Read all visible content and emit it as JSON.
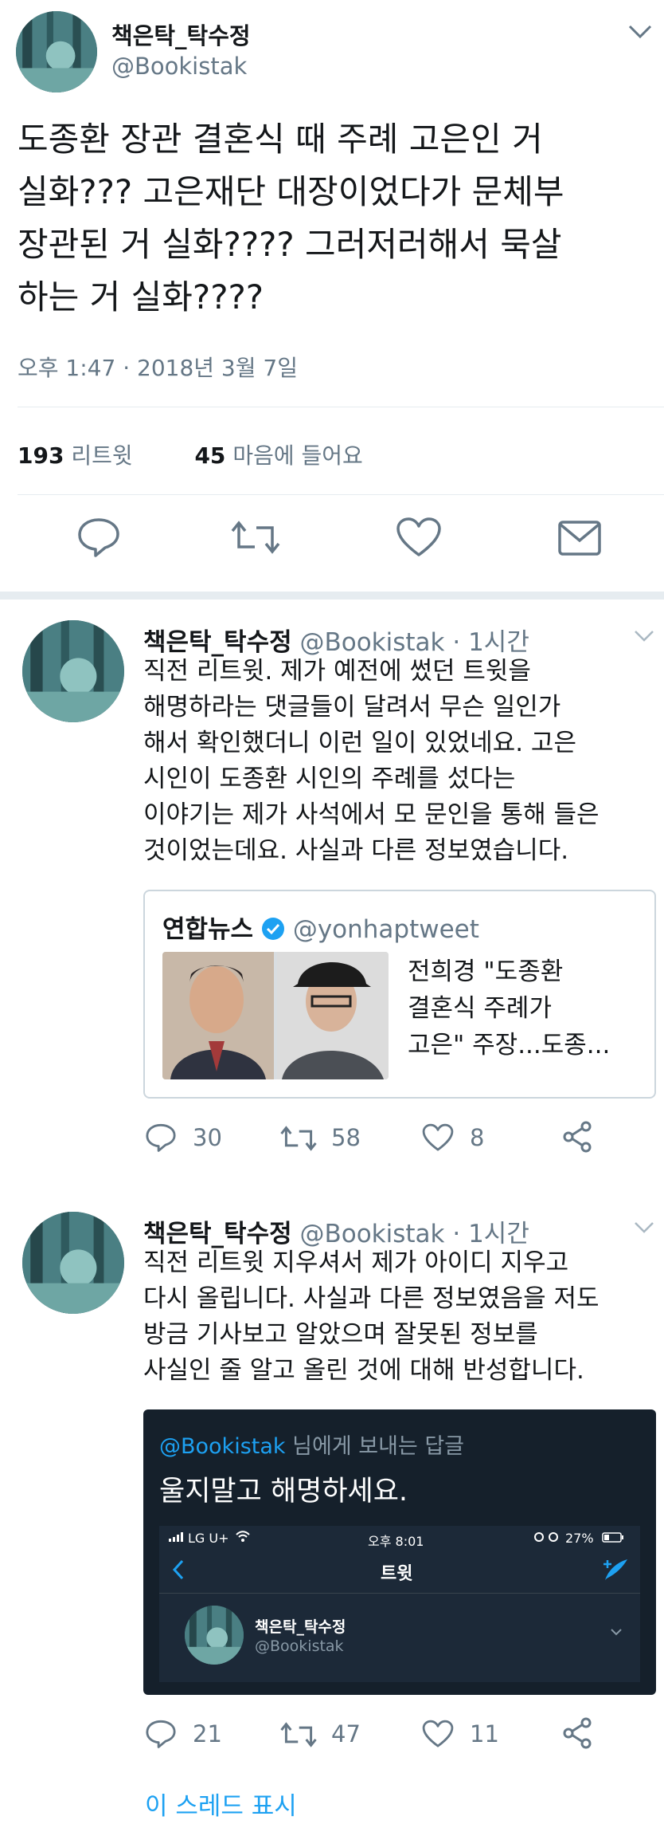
{
  "main_tweet": {
    "display_name": "책은탁_탁수정",
    "handle": "@Bookistak",
    "text_lines": [
      "도종환 장관 결혼식 때 주례 고은인 거",
      "실화??? 고은재단 대장이었다가 문체부",
      "장관된 거 실화???? 그러저러해서 묵살",
      "하는 거 실화????"
    ],
    "timestamp": "오후 1:47 · 2018년 3월 7일",
    "retweet_count": "193",
    "retweet_label": "리트윗",
    "like_count": "45",
    "like_label": "마음에 들어요"
  },
  "reply1": {
    "display_name": "책은탁_탁수정",
    "handle": "@Bookistak",
    "time": "· 1시간",
    "text_lines": [
      "직전 리트윗. 제가 예전에 썼던 트윗을",
      "해명하라는 댓글들이 달려서 무슨 일인가",
      "해서 확인했더니 이런 일이 있었네요. 고은",
      "시인이 도종환 시인의 주례를 섰다는",
      "이야기는 제가 사석에서 모 문인을 통해 들은",
      "것이었는데요. 사실과 다른 정보였습니다."
    ],
    "quote": {
      "name": "연합뉴스",
      "handle": "@yonhaptweet",
      "text_lines": [
        "전희경 \"도종환",
        "결혼식 주례가",
        "고은\" 주장...도종..."
      ]
    },
    "reply_count": "30",
    "retweet_count": "58",
    "like_count": "8"
  },
  "reply2": {
    "display_name": "책은탁_탁수정",
    "handle": "@Bookistak",
    "time": "· 1시간",
    "text_lines": [
      "직전 리트윗 지우셔서 제가 아이디 지우고",
      "다시 올립니다. 사실과 다른 정보였음을 저도",
      "방금 기사보고 알았으며 잘못된 정보를",
      "사실인 줄 알고 올린 것에 대해 반성합니다."
    ],
    "image": {
      "reply_to_handle": "@Bookistak",
      "reply_to_label": "님에게 보내는 답글",
      "headline": "울지말고 해명하세요.",
      "status_carrier": "LG U+",
      "status_time": "오후 8:01",
      "status_battery": "27%",
      "nav_title": "트윗",
      "inner_name": "책은탁_탁수정",
      "inner_handle": "@Bookistak"
    },
    "reply_count": "21",
    "retweet_count": "47",
    "like_count": "11"
  },
  "show_thread": "이 스레드 표시",
  "colors": {
    "link_blue": "#1da1f2",
    "muted_gray": "#657786",
    "dark_panel": "#15202b"
  }
}
